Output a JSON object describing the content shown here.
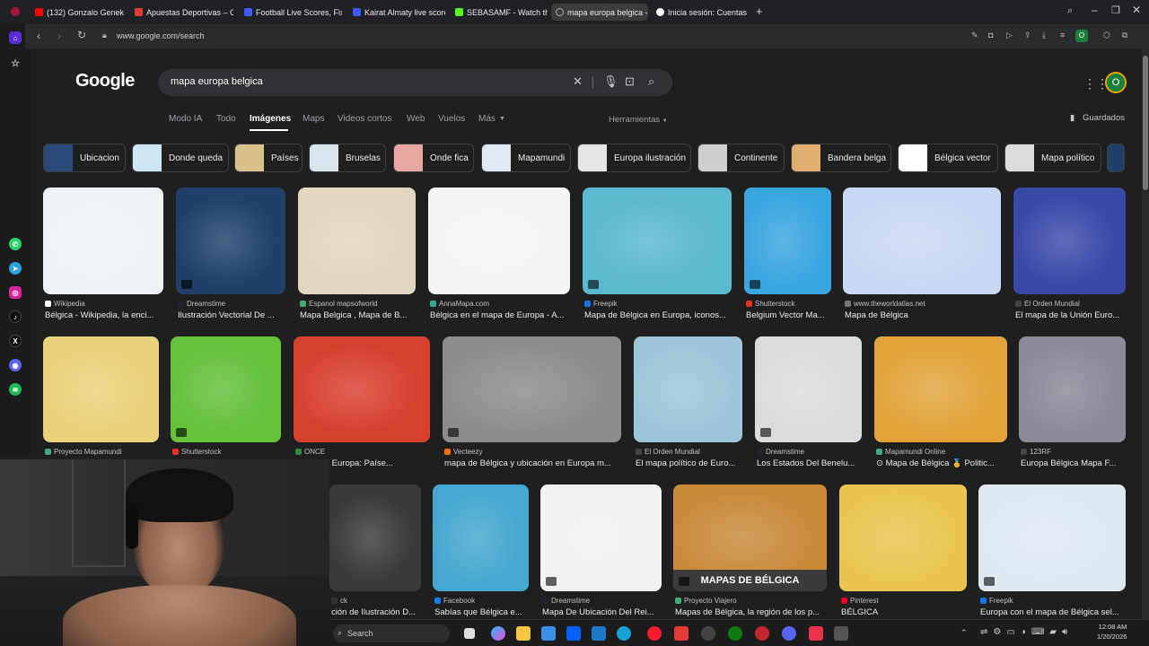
{
  "browser": {
    "tabs": [
      {
        "label": "(132) Gonzalo Genek",
        "color": "#ff0000",
        "prefix": "◀ ✕"
      },
      {
        "label": "Apuestas Deportivas – Ca",
        "color": "#e53935"
      },
      {
        "label": "Football Live Scores, Fixtu",
        "color": "#3d5afe"
      },
      {
        "label": "Kairat Almaty live score, s",
        "color": "#3d5afe"
      },
      {
        "label": "SEBASAMF - Watch the V",
        "color": "#53fc18"
      },
      {
        "label": "mapa europa belgica - B",
        "color": "#888888",
        "active": true
      },
      {
        "label": "Inicia sesión: Cuentas de G",
        "color": "#ffffff"
      }
    ],
    "new_tab": "+",
    "url": "www.google.com/search",
    "profile_initial": "O"
  },
  "google": {
    "logo": "Google",
    "query": "mapa europa belgica",
    "filters": [
      "Modo IA",
      "Todo",
      "Imágenes",
      "Maps",
      "Videos cortos",
      "Web",
      "Vuelos",
      "Más"
    ],
    "active_filter": "Imágenes",
    "tools_label": "Herramientas",
    "saved_label": "Guardados",
    "avatar_initial": "O"
  },
  "chips": [
    {
      "label": "Ubicacion",
      "tone": "#2a4a7a"
    },
    {
      "label": "Donde queda",
      "tone": "#cfe6f2"
    },
    {
      "label": "Países",
      "tone": "#d9c28a"
    },
    {
      "label": "Bruselas",
      "tone": "#d8e6ee"
    },
    {
      "label": "Onde fica",
      "tone": "#e8a8a0"
    },
    {
      "label": "Mapamundi",
      "tone": "#dfe8f4"
    },
    {
      "label": "Europa ilustración",
      "tone": "#e6e6e6"
    },
    {
      "label": "Continente",
      "tone": "#cfcfcf"
    },
    {
      "label": "Bandera belga",
      "tone": "#e0b070"
    },
    {
      "label": "Bélgica vector",
      "tone": "#ffffff"
    },
    {
      "label": "Mapa político",
      "tone": "#dcdcdc"
    }
  ],
  "results_row1": [
    {
      "source": "Wikipedia",
      "title": "Bélgica - Wikipedia, la enci...",
      "tone": "#eef2f6",
      "fav": "#ffffff"
    },
    {
      "source": "Dreamstime",
      "title": "Ilustración Vectorial De ...",
      "tone": "#20406a",
      "fav": "#223",
      "video": true
    },
    {
      "source": "Espanol mapsofworld",
      "title": "Mapa Belgica , Mapa de B...",
      "tone": "#e3d6c0",
      "fav": "#4a7"
    },
    {
      "source": "AnnaMapa.com",
      "title": "Bélgica en el mapa de Europa - A...",
      "tone": "#f3f5f7",
      "fav": "#3a9"
    },
    {
      "source": "Freepik",
      "title": "Mapa de Bélgica en Europa, iconos...",
      "tone": "#5ab8cf",
      "fav": "#1273eb",
      "video": true
    },
    {
      "source": "Shutterstock",
      "title": "Belgium Vector Ma...",
      "tone": "#3aa6e0",
      "fav": "#ee2d24",
      "video": true
    },
    {
      "source": "www.theworldatlas.net",
      "title": "Mapa de Bélgica",
      "tone": "#c9d8f2",
      "fav": "#777"
    },
    {
      "source": "El Orden Mundial",
      "title": "El mapa de la Unión Euro...",
      "tone": "#3a48a8",
      "fav": "#444"
    }
  ],
  "results_row2": [
    {
      "source": "Proyecto Mapamundi",
      "title": "",
      "tone": "#e9d27a",
      "fav": "#4a7"
    },
    {
      "source": "Shutterstock",
      "title": "",
      "tone": "#63c13a",
      "fav": "#ee2d24",
      "video": true
    },
    {
      "source": "ONCE",
      "title": "olítico de Europa: Paíse...",
      "tone": "#d8402e",
      "fav": "#2a8a3a"
    },
    {
      "source": "Vecteezy",
      "title": "mapa de Bélgica y ubicación en Europa m...",
      "tone": "#8c8c8c",
      "fav": "#ff6a00",
      "video": true
    },
    {
      "source": "El Orden Mundial",
      "title": "El mapa político de Euro...",
      "tone": "#9cc6d8",
      "fav": "#444"
    },
    {
      "source": "Dreamstime",
      "title": "Los Estados Del Benelu...",
      "tone": "#dcdcdc",
      "fav": "#223",
      "video": true
    },
    {
      "source": "Mapamundi Online",
      "title": "⊙ Mapa de Bélgica 🏅 Politic...",
      "tone": "#e2a33a",
      "fav": "#4a7"
    },
    {
      "source": "123RF",
      "title": "Europa Bélgica Mapa F...",
      "tone": "#8a8a98",
      "fav": "#444"
    }
  ],
  "results_row3": [
    {
      "source": "ck",
      "title": "ción de Ilustración D...",
      "tone": "#3a3a3a",
      "fav": "#333",
      "video": false
    },
    {
      "source": "Facebook",
      "title": "Sabías que Bélgica e...",
      "tone": "#45a8d0",
      "fav": "#1877f2"
    },
    {
      "source": "Dreamstime",
      "title": "Mapa De Ubicación Del Rei...",
      "tone": "#f0f0f0",
      "fav": "#223",
      "video": true
    },
    {
      "source": "Proyecto Viajero",
      "title": "Mapas de Bélgica, la región de los p...",
      "tone": "#c98a3a",
      "fav": "#4a7",
      "overlay": "MAPAS DE BÉLGICA",
      "video": true
    },
    {
      "source": "Pinterest",
      "title": "BÉLGICA",
      "tone": "#e9c550",
      "fav": "#e60023"
    },
    {
      "source": "Freepik",
      "title": "Europa con el mapa de Bélgica sel...",
      "tone": "#dde8f2",
      "fav": "#1273eb",
      "video": true
    }
  ],
  "taskbar": {
    "search_label": "Search",
    "time": "12:08 AM",
    "date": "1/20/2026"
  }
}
